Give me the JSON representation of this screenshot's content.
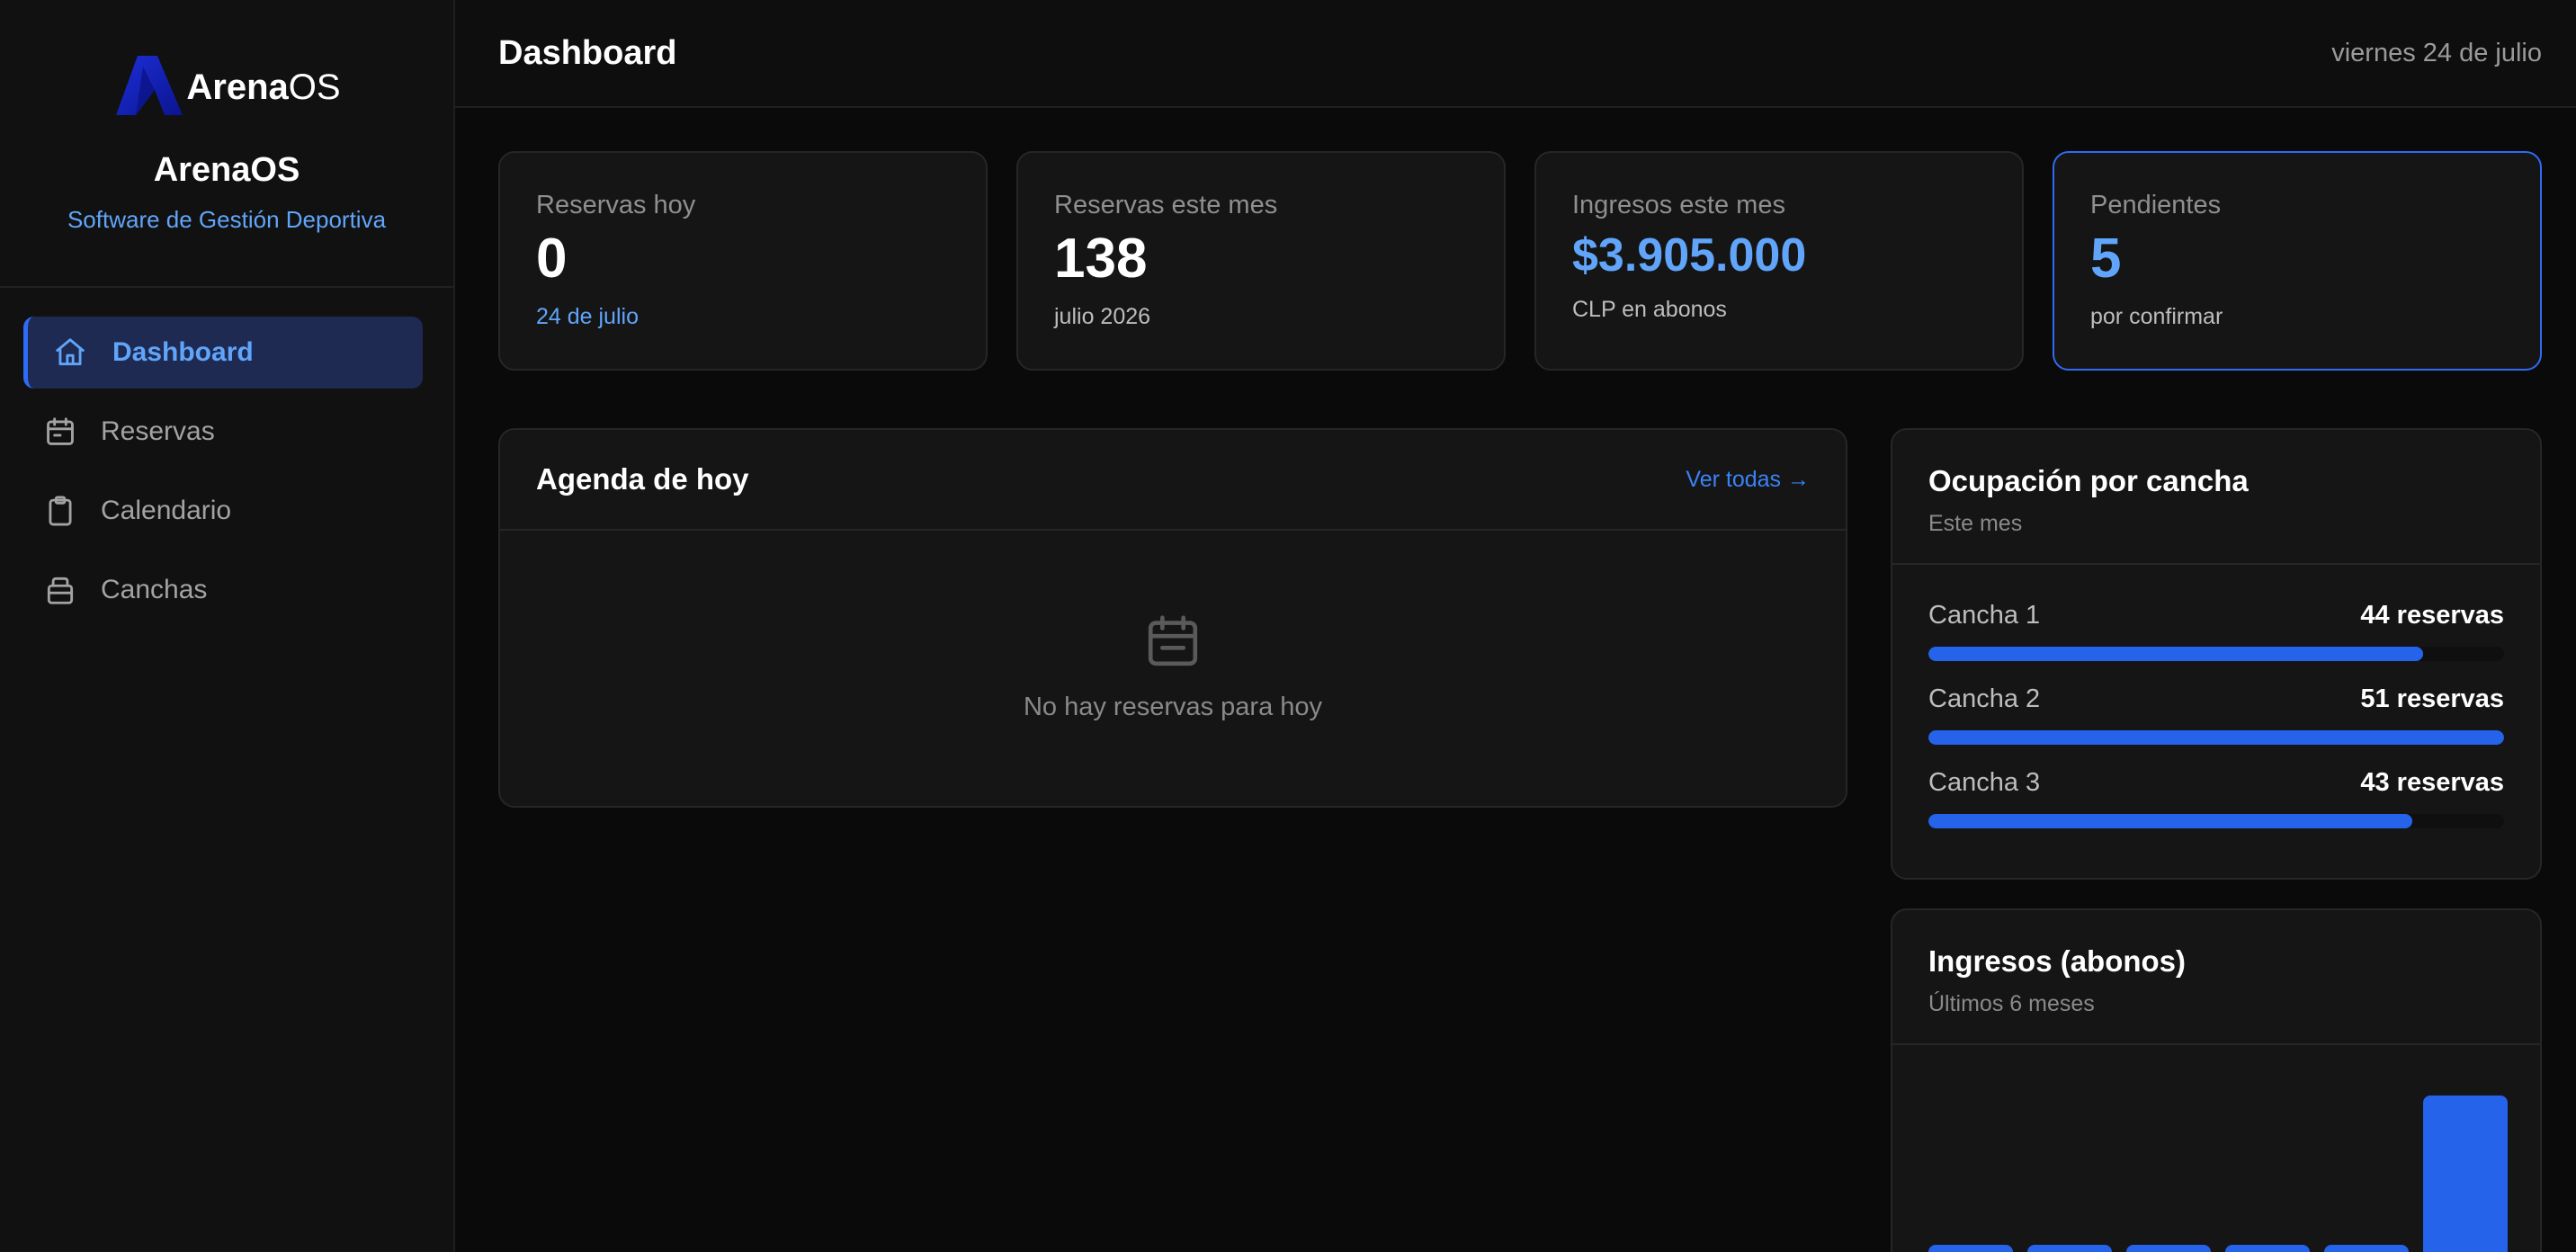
{
  "brand": {
    "logo_bold": "Arena",
    "logo_light": "OS",
    "name": "ArenaOS",
    "subtitle": "Software de Gestión Deportiva"
  },
  "nav": {
    "items": [
      {
        "label": "Dashboard",
        "icon": "home-icon",
        "active": true
      },
      {
        "label": "Reservas",
        "icon": "calendar-icon"
      },
      {
        "label": "Calendario",
        "icon": "clipboard-icon"
      },
      {
        "label": "Canchas",
        "icon": "court-icon"
      }
    ]
  },
  "header": {
    "title": "Dashboard",
    "date": "viernes 24 de julio"
  },
  "stats": [
    {
      "label": "Reservas hoy",
      "value": "0",
      "sub": "24 de julio"
    },
    {
      "label": "Reservas este mes",
      "value": "138",
      "sub": "julio 2026"
    },
    {
      "label": "Ingresos este mes",
      "value": "$3.905.000",
      "sub": "CLP en abonos"
    },
    {
      "label": "Pendientes",
      "value": "5",
      "sub": "por confirmar"
    }
  ],
  "agenda": {
    "title": "Agenda de hoy",
    "link": "Ver todas →",
    "empty_text": "No hay reservas para hoy"
  },
  "occupancy": {
    "title": "Ocupación por cancha",
    "subtitle": "Este mes",
    "items": [
      {
        "name": "Cancha 1",
        "value": "44 reservas",
        "fraction": 0.86
      },
      {
        "name": "Cancha 2",
        "value": "51 reservas",
        "fraction": 1.0
      },
      {
        "name": "Cancha 3",
        "value": "43 reservas",
        "fraction": 0.84
      }
    ]
  },
  "income": {
    "title": "Ingresos (abonos)",
    "subtitle": "Últimos 6 meses"
  },
  "chart_data": {
    "type": "bar",
    "values": [
      0.05,
      0.05,
      0.05,
      0.05,
      0.1,
      3.905
    ],
    "ylim": [
      0,
      4.5
    ]
  },
  "colors": {
    "accent": "#2563eb",
    "accent_light": "#60a5fa",
    "background": "#0a0a0a"
  }
}
